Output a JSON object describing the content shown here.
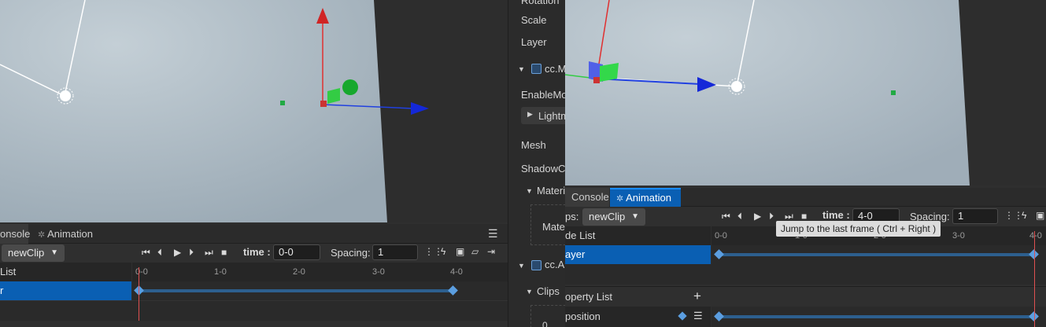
{
  "left": {
    "tabs": {
      "console": "onsole",
      "animation": "Animation"
    },
    "menu_icon": "menu-icon",
    "clip_dropdown": "newClip",
    "time_label": "time :",
    "time_value": "0-0",
    "spacing_label": "Spacing:",
    "spacing_value": "1",
    "node_list_header": "List",
    "selected_node": "r",
    "ruler_ticks": [
      "0-0",
      "1-0",
      "2-0",
      "3-0",
      "4-0"
    ]
  },
  "inspector": {
    "items": [
      "Rotation",
      "Scale",
      "Layer",
      "cc.M",
      "EnableMo",
      "Lightm",
      "Mesh",
      "ShadowCa",
      "Materi",
      "Mate",
      "cc.A",
      "Clips",
      "0"
    ]
  },
  "right": {
    "tabs": {
      "console": "Console",
      "animation": "Animation"
    },
    "clips_label": "ps:",
    "clip_dropdown": "newClip",
    "time_label": "time :",
    "time_value": "4-0",
    "spacing_label": "Spacing:",
    "spacing_value": "1",
    "tooltip": "Jump to the last frame ( Ctrl + Right )",
    "node_list_header": "de List",
    "selected_node": "ayer",
    "property_list_header": "operty List",
    "property_row": "position",
    "ruler_ticks": [
      "0-0",
      "1-0",
      "2-0",
      "3-0",
      "4-0"
    ]
  },
  "colors": {
    "accent": "#0a5fb3",
    "keyframe": "#5b9ee0",
    "playhead": "#e05050",
    "scene_floor": "#a9b7c1",
    "scene_dark": "#2d2d2d"
  }
}
